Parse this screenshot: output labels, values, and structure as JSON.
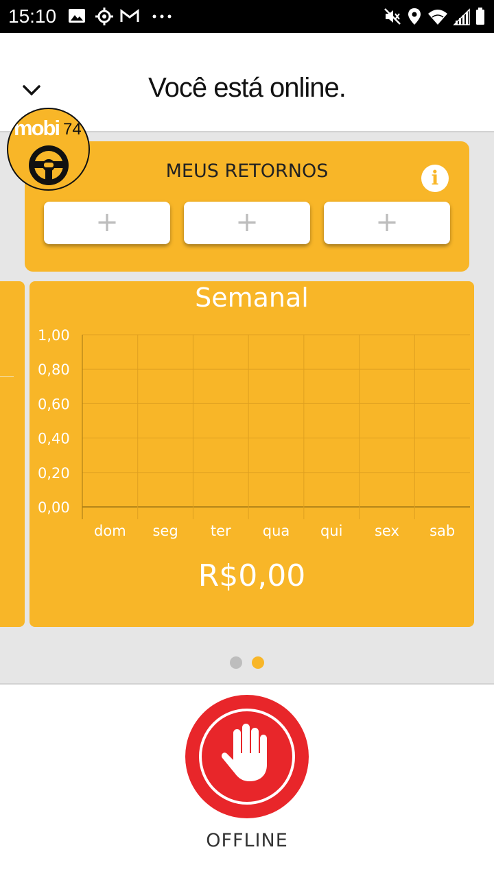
{
  "status_bar": {
    "time": "15:10",
    "icons_left": [
      "image-icon",
      "location-target-icon",
      "gmail-icon",
      "more-dots-icon"
    ],
    "icons_right": [
      "mute-icon",
      "location-pin-icon",
      "wifi-icon",
      "signal-icon",
      "battery-icon"
    ]
  },
  "header": {
    "title": "Você está online."
  },
  "logo": {
    "text": "mobi",
    "number": "74"
  },
  "retornos": {
    "title": "MEUS RETORNOS",
    "info": "i",
    "slots": [
      "+",
      "+",
      "+"
    ]
  },
  "weekly": {
    "title": "Semanal",
    "total": "R$0,00"
  },
  "chart_data": {
    "type": "bar",
    "title": "Semanal",
    "categories": [
      "dom",
      "seg",
      "ter",
      "qua",
      "qui",
      "sex",
      "sab"
    ],
    "values": [
      0,
      0,
      0,
      0,
      0,
      0,
      0
    ],
    "yticks": [
      "0,00",
      "0,20",
      "0,40",
      "0,60",
      "0,80",
      "1,00"
    ],
    "ylim": [
      0,
      1
    ],
    "grid": true
  },
  "pagination": {
    "count": 2,
    "active": 1,
    "active_color": "#f8b628",
    "inactive_color": "#bdbdbd"
  },
  "offline_button": {
    "label": "OFFLINE",
    "color": "#e8262a"
  },
  "colors": {
    "accent": "#f8b628",
    "danger": "#e8262a"
  }
}
